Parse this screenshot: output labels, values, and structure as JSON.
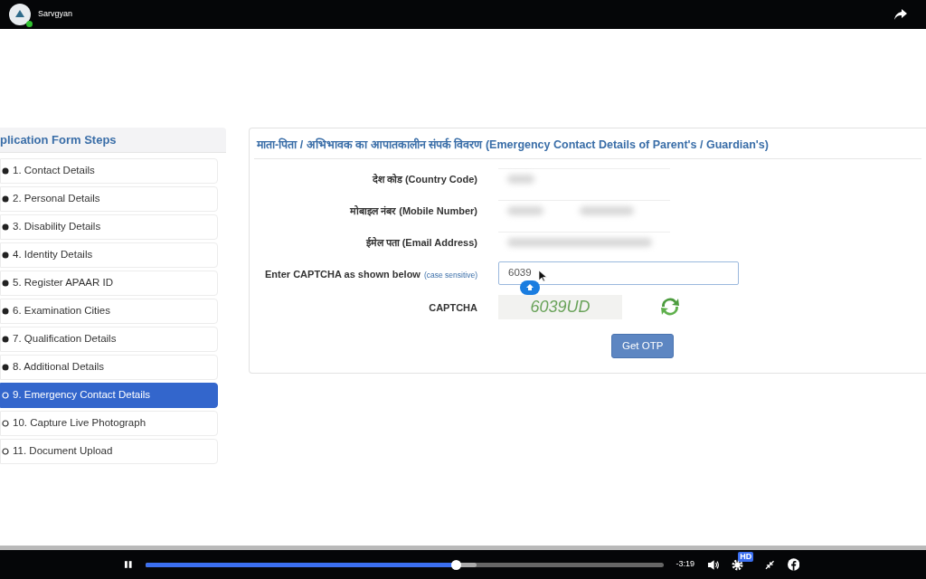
{
  "video_header": {
    "channel": "Sarvgyan",
    "live": true
  },
  "sidebar": {
    "title": "plication Form Steps",
    "items": [
      {
        "label": "1. Contact Details",
        "completed": true,
        "selected": false
      },
      {
        "label": "2. Personal Details",
        "completed": true,
        "selected": false
      },
      {
        "label": "3. Disability Details",
        "completed": true,
        "selected": false
      },
      {
        "label": "4. Identity Details",
        "completed": true,
        "selected": false
      },
      {
        "label": "5. Register APAAR ID",
        "completed": true,
        "selected": false
      },
      {
        "label": "6. Examination Cities",
        "completed": true,
        "selected": false
      },
      {
        "label": "7. Qualification Details",
        "completed": true,
        "selected": false
      },
      {
        "label": "8. Additional Details",
        "completed": true,
        "selected": false
      },
      {
        "label": "9. Emergency Contact Details",
        "completed": false,
        "selected": true
      },
      {
        "label": "10. Capture Live Photograph",
        "completed": false,
        "selected": false
      },
      {
        "label": "11. Document Upload",
        "completed": false,
        "selected": false
      }
    ]
  },
  "form": {
    "title": "माता-पिता / अभिभावक का आपातकालीन संपर्क विवरण (Emergency Contact Details of Parent's / Guardian's)",
    "fields": [
      {
        "kind": "redacted",
        "label": "देश कोड (Country Code)"
      },
      {
        "kind": "redacted_pair",
        "label": "मोबाइल नंबर (Mobile Number)"
      },
      {
        "kind": "redacted",
        "label": "ईमेल पता (Email Address)"
      },
      {
        "kind": "input",
        "label": "Enter CAPTCHA as shown below",
        "hint": "(case sensitive)",
        "value": "6039"
      }
    ],
    "captcha": {
      "label": "CAPTCHA",
      "code": "6039UD"
    },
    "button": "Get OTP"
  },
  "player": {
    "playing": true,
    "level": 0.6,
    "time": "-3:19",
    "quality": "HD"
  }
}
